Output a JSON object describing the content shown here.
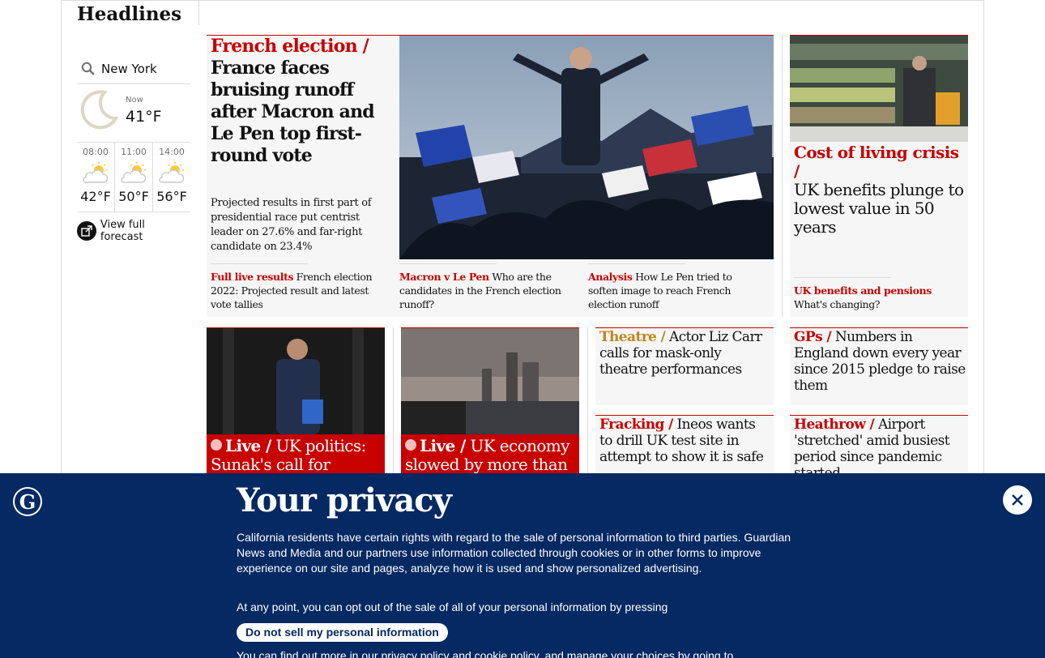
{
  "section": {
    "title": "Headlines"
  },
  "weather": {
    "location": "New York",
    "now_label": "Now",
    "now_temp": "41°F",
    "forecast": [
      {
        "time": "08:00",
        "temp": "42°F"
      },
      {
        "time": "11:00",
        "temp": "50°F"
      },
      {
        "time": "14:00",
        "temp": "56°F"
      }
    ],
    "view_forecast": "View full forecast"
  },
  "main_story": {
    "kicker": "French election /",
    "headline": "France faces bruising runoff after Macron and Le Pen top first-round vote",
    "standfirst": "Projected results in first part of presidential race put centrist leader on 27.6% and far-right candidate on 23.4%",
    "sublinks": [
      {
        "kicker": "Full live results",
        "text": "French election 2022: Projected result and latest vote tallies"
      },
      {
        "kicker": "Macron v Le Pen",
        "text": "Who are the candidates in the French election runoff?"
      },
      {
        "kicker": "Analysis",
        "text": "How Le Pen tried to soften image to reach French election runoff"
      }
    ]
  },
  "col_story": {
    "kicker": "Cost of living crisis /",
    "headline": "UK benefits plunge to lowest value in 50 years",
    "sublink_kicker": "UK benefits and pensions",
    "sublink_text": "What's changing?"
  },
  "row2": {
    "live1": {
      "kicker": "Live /",
      "headline": "UK politics: Sunak's call for inquiry"
    },
    "live2": {
      "kicker": "Live /",
      "headline": "UK economy slowed by more than"
    },
    "theatre": {
      "kicker": "Theatre /",
      "headline": "Actor Liz Carr calls for mask-only theatre performances"
    },
    "gps": {
      "kicker": "GPs /",
      "headline": "Numbers in England down every year since 2015 pledge to raise them"
    },
    "fracking": {
      "kicker": "Fracking /",
      "headline": "Ineos wants to drill UK test site in attempt to show it is safe"
    },
    "heathrow": {
      "kicker": "Heathrow  /",
      "headline": "Airport 'stretched' amid busiest period since pandemic started"
    }
  },
  "privacy": {
    "title": "Your privacy",
    "para1": "California residents have certain rights with regard to the sale of personal information to third parties. Guardian News and Media and our partners use information collected through cookies or in other forms to improve experience on our site and pages, analyze how it is used and show personalized advertising.",
    "para2": "At any point, you can opt out of the sale of all of your personal information by pressing",
    "button": "Do not sell my personal information",
    "para3": "You can find out more in our privacy policy and cookie policy, and manage your choices by going to"
  },
  "colors": {
    "kicker_red": "#c70000",
    "banner_navy": "#052962",
    "card_bg": "#f6f6f6"
  }
}
